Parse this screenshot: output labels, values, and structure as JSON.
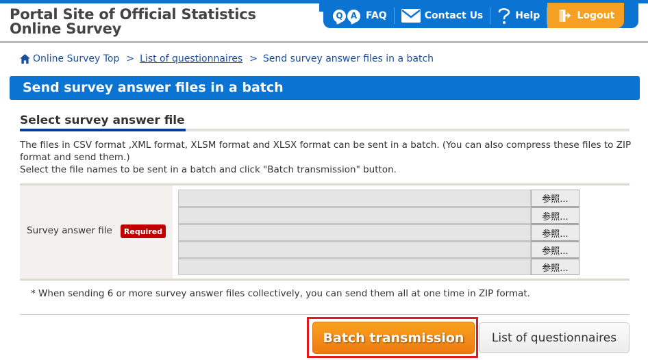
{
  "header": {
    "site_title_line1": "Portal Site of Official Statistics",
    "site_title_line2": "Online Survey",
    "nav": {
      "faq": {
        "label": "FAQ",
        "icon": "qa-icon",
        "icon_letters": [
          "Q",
          "A"
        ]
      },
      "contact": {
        "label": "Contact Us",
        "icon": "mail-icon"
      },
      "help": {
        "label": "Help",
        "icon": "question-mark-icon"
      },
      "logout": {
        "label": "Logout",
        "icon": "exit-door-icon"
      }
    },
    "colors": {
      "nav_bg": "#0b74d2",
      "logout_bg": "#f5a023"
    }
  },
  "breadcrumb": {
    "items": [
      {
        "label": "Online Survey Top",
        "icon": "home-icon",
        "link": false
      },
      {
        "label": "List of questionnaires",
        "link": true
      },
      {
        "label": "Send survey answer files in a batch",
        "link": false
      }
    ],
    "separator": ">"
  },
  "page": {
    "title": "Send survey answer files in a batch",
    "section_heading": "Select survey answer file",
    "description_line1": "The files in CSV format ,XML format, XLSM format and XLSX format can be sent in a batch. (You can also compress these files to ZIP format and send them.)",
    "description_line2": "Select the file names to be sent in a batch and click \"Batch transmission\" button."
  },
  "form": {
    "field_label": "Survey answer file",
    "required_badge": "Required",
    "file_inputs": [
      {
        "value": "",
        "browse_label": "参照..."
      },
      {
        "value": "",
        "browse_label": "参照..."
      },
      {
        "value": "",
        "browse_label": "参照..."
      },
      {
        "value": "",
        "browse_label": "参照..."
      },
      {
        "value": "",
        "browse_label": "参照..."
      }
    ],
    "note": "* When sending 6 or more survey answer files collectively, you can send them all at one time in ZIP format."
  },
  "actions": {
    "batch_transmission": "Batch transmission",
    "list_of_questionnaires": "List of questionnaires"
  }
}
